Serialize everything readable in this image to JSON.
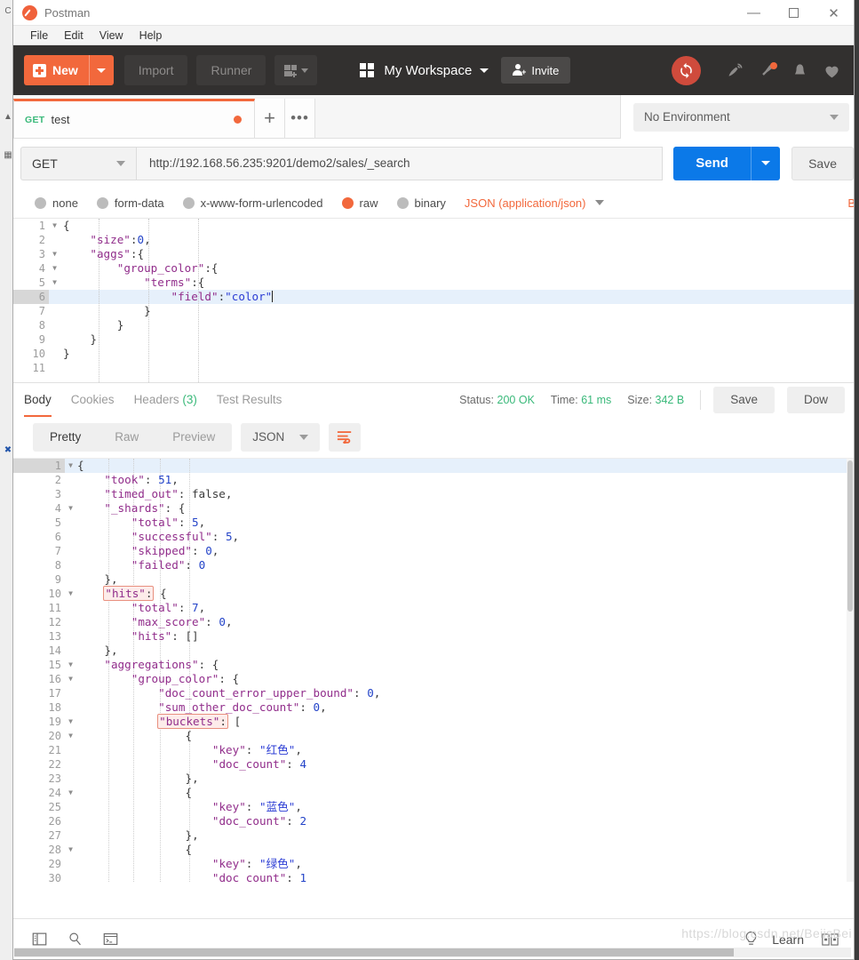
{
  "window": {
    "app_title": "Postman",
    "logo_icon": "postman-logo-icon",
    "minimize_icon": "minimize-icon",
    "maximize_icon": "maximize-icon",
    "close_icon": "close-icon"
  },
  "menubar": {
    "items": [
      "File",
      "Edit",
      "View",
      "Help"
    ]
  },
  "header": {
    "new_label": "New",
    "import_label": "Import",
    "runner_label": "Runner",
    "workspace_label": "My Workspace",
    "invite_label": "Invite",
    "accent_orange": "#f2683c",
    "sync_color": "#cf4b3c",
    "icons": [
      "new-window-icon",
      "grid-icon",
      "sync-icon",
      "satellite-icon",
      "megaphone-icon",
      "bell-icon",
      "heart-icon"
    ]
  },
  "tabs": {
    "items": [
      {
        "method": "GET",
        "name": "test",
        "unsaved": true
      }
    ],
    "new_tab_label": "+",
    "more_label": "•••",
    "environment": {
      "value": "No Environment"
    }
  },
  "request": {
    "method": "GET",
    "url": "http://192.168.56.235:9201/demo2/sales/_search",
    "send_label": "Send",
    "save_label": "Save",
    "body_types": [
      {
        "label": "none",
        "selected": false
      },
      {
        "label": "form-data",
        "selected": false
      },
      {
        "label": "x-www-form-urlencoded",
        "selected": false
      },
      {
        "label": "raw",
        "selected": true
      },
      {
        "label": "binary",
        "selected": false
      }
    ],
    "content_type": "JSON (application/json)",
    "beautify_label": "B",
    "editor": {
      "active_line": 6,
      "lines": [
        {
          "n": 1,
          "fold": true,
          "text": "{"
        },
        {
          "n": 2,
          "fold": false,
          "text": "    \"size\":0,"
        },
        {
          "n": 3,
          "fold": true,
          "text": "    \"aggs\":{"
        },
        {
          "n": 4,
          "fold": true,
          "text": "        \"group_color\":{"
        },
        {
          "n": 5,
          "fold": true,
          "text": "            \"terms\":{"
        },
        {
          "n": 6,
          "fold": false,
          "text": "                \"field\":\"color\""
        },
        {
          "n": 7,
          "fold": false,
          "text": "            }"
        },
        {
          "n": 8,
          "fold": false,
          "text": "        }"
        },
        {
          "n": 9,
          "fold": false,
          "text": "    }"
        },
        {
          "n": 10,
          "fold": false,
          "text": "}"
        },
        {
          "n": 11,
          "fold": false,
          "text": ""
        }
      ]
    }
  },
  "response": {
    "tabs": [
      {
        "label": "Body",
        "active": true,
        "count": ""
      },
      {
        "label": "Cookies",
        "active": false,
        "count": ""
      },
      {
        "label": "Headers",
        "active": false,
        "count": "(3)"
      },
      {
        "label": "Test Results",
        "active": false,
        "count": ""
      }
    ],
    "status_label": "Status:",
    "status_value": "200 OK",
    "time_label": "Time:",
    "time_value": "61 ms",
    "size_label": "Size:",
    "size_value": "342 B",
    "save_label": "Save",
    "download_label": "Dow",
    "view_modes": [
      {
        "label": "Pretty",
        "active": true
      },
      {
        "label": "Raw",
        "active": false
      },
      {
        "label": "Preview",
        "active": false
      }
    ],
    "language": "JSON",
    "wrap_icon": "word-wrap-icon",
    "body": {
      "active_line": 1,
      "lines": [
        {
          "n": 1,
          "fold": true,
          "text": "{"
        },
        {
          "n": 2,
          "fold": false,
          "text": "    \"took\": 51,"
        },
        {
          "n": 3,
          "fold": false,
          "text": "    \"timed_out\": false,"
        },
        {
          "n": 4,
          "fold": true,
          "text": "    \"_shards\": {"
        },
        {
          "n": 5,
          "fold": false,
          "text": "        \"total\": 5,"
        },
        {
          "n": 6,
          "fold": false,
          "text": "        \"successful\": 5,"
        },
        {
          "n": 7,
          "fold": false,
          "text": "        \"skipped\": 0,"
        },
        {
          "n": 8,
          "fold": false,
          "text": "        \"failed\": 0"
        },
        {
          "n": 9,
          "fold": false,
          "text": "    },"
        },
        {
          "n": 10,
          "fold": true,
          "text": "    \"hits\": {",
          "highlight": "\"hits\":"
        },
        {
          "n": 11,
          "fold": false,
          "text": "        \"total\": 7,"
        },
        {
          "n": 12,
          "fold": false,
          "text": "        \"max_score\": 0,"
        },
        {
          "n": 13,
          "fold": false,
          "text": "        \"hits\": []"
        },
        {
          "n": 14,
          "fold": false,
          "text": "    },"
        },
        {
          "n": 15,
          "fold": true,
          "text": "    \"aggregations\": {"
        },
        {
          "n": 16,
          "fold": true,
          "text": "        \"group_color\": {"
        },
        {
          "n": 17,
          "fold": false,
          "text": "            \"doc_count_error_upper_bound\": 0,"
        },
        {
          "n": 18,
          "fold": false,
          "text": "            \"sum_other_doc_count\": 0,"
        },
        {
          "n": 19,
          "fold": true,
          "text": "            \"buckets\": [",
          "highlight": "\"buckets\":"
        },
        {
          "n": 20,
          "fold": true,
          "text": "                {"
        },
        {
          "n": 21,
          "fold": false,
          "text": "                    \"key\": \"红色\","
        },
        {
          "n": 22,
          "fold": false,
          "text": "                    \"doc_count\": 4"
        },
        {
          "n": 23,
          "fold": false,
          "text": "                },"
        },
        {
          "n": 24,
          "fold": true,
          "text": "                {"
        },
        {
          "n": 25,
          "fold": false,
          "text": "                    \"key\": \"蓝色\","
        },
        {
          "n": 26,
          "fold": false,
          "text": "                    \"doc_count\": 2"
        },
        {
          "n": 27,
          "fold": false,
          "text": "                },"
        },
        {
          "n": 28,
          "fold": true,
          "text": "                {"
        },
        {
          "n": 29,
          "fold": false,
          "text": "                    \"key\": \"绿色\","
        },
        {
          "n": 30,
          "fold": false,
          "text": "                    \"doc_count\": 1"
        }
      ]
    }
  },
  "bottombar": {
    "icons": [
      "sidebar-toggle-icon",
      "search-icon",
      "console-icon"
    ],
    "learn_label": "Learn",
    "bulb_icon": "bulb-icon",
    "layout_icon": "two-pane-icon"
  },
  "watermark": "https://blog.csdn.net/BeiisBei"
}
